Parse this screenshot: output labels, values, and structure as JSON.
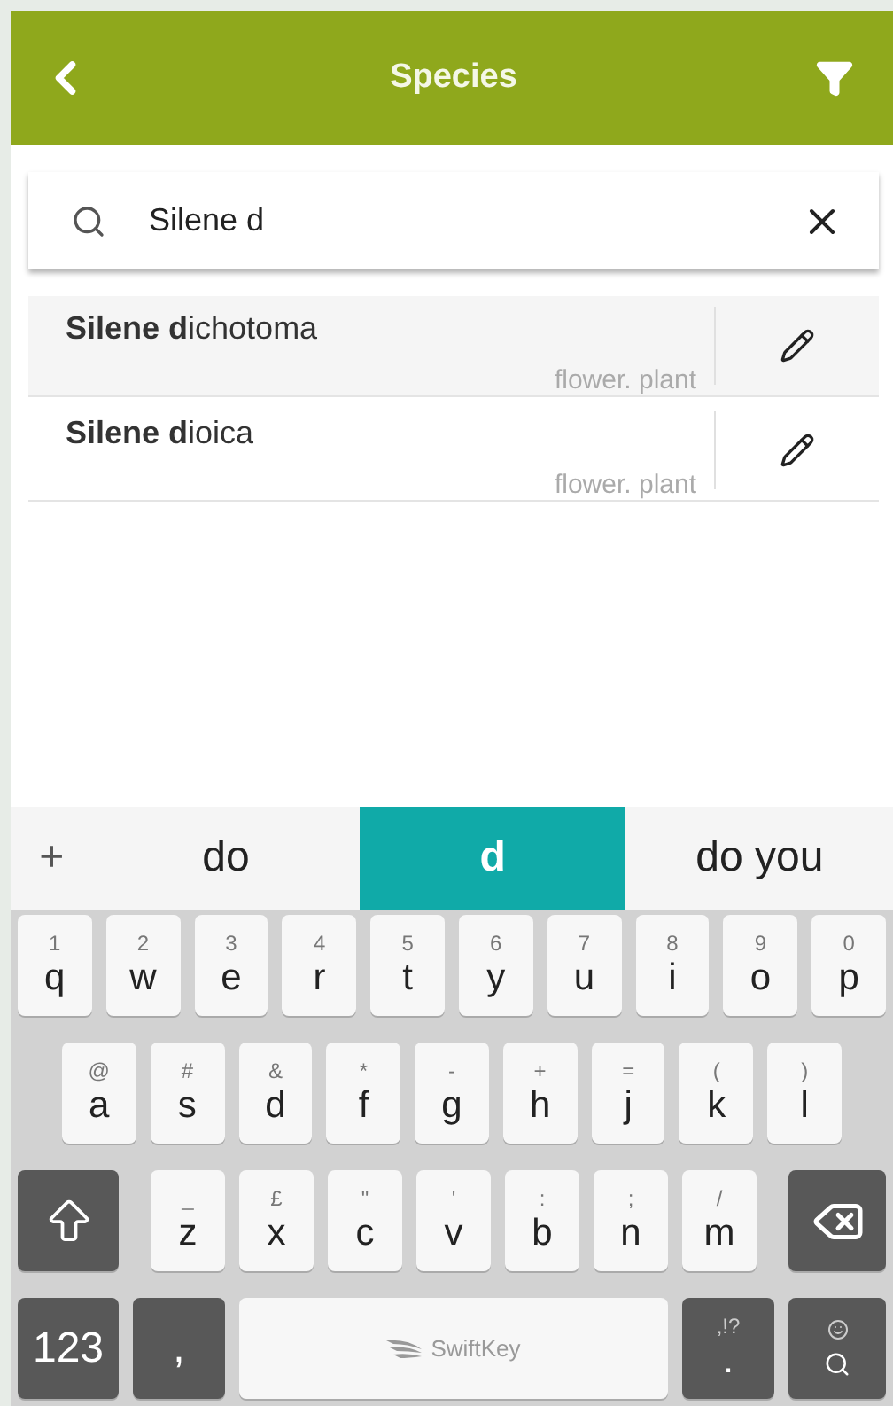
{
  "header": {
    "title": "Species"
  },
  "search": {
    "value": "Silene d"
  },
  "results": [
    {
      "name": "**Silene d**ichotoma",
      "tags": "flower. plant"
    },
    {
      "name": "**Silene d**ioica",
      "tags": "flower. plant"
    }
  ],
  "keyboard": {
    "add": "+",
    "suggestions": [
      {
        "text": "do",
        "selected": false
      },
      {
        "text": "d",
        "selected": true
      },
      {
        "text": "do you",
        "selected": false
      }
    ],
    "rows": [
      [
        {
          "kind": "char",
          "main": "q",
          "alt": "1"
        },
        {
          "kind": "char",
          "main": "w",
          "alt": "2"
        },
        {
          "kind": "char",
          "main": "e",
          "alt": "3"
        },
        {
          "kind": "char",
          "main": "r",
          "alt": "4"
        },
        {
          "kind": "char",
          "main": "t",
          "alt": "5"
        },
        {
          "kind": "char",
          "main": "y",
          "alt": "6"
        },
        {
          "kind": "char",
          "main": "u",
          "alt": "7"
        },
        {
          "kind": "char",
          "main": "i",
          "alt": "8"
        },
        {
          "kind": "char",
          "main": "o",
          "alt": "9"
        },
        {
          "kind": "char",
          "main": "p",
          "alt": "0"
        }
      ],
      [
        {
          "kind": "char",
          "main": "a",
          "alt": "@"
        },
        {
          "kind": "char",
          "main": "s",
          "alt": "#"
        },
        {
          "kind": "char",
          "main": "d",
          "alt": "&"
        },
        {
          "kind": "char",
          "main": "f",
          "alt": "*"
        },
        {
          "kind": "char",
          "main": "g",
          "alt": "-"
        },
        {
          "kind": "char",
          "main": "h",
          "alt": "+"
        },
        {
          "kind": "char",
          "main": "j",
          "alt": "="
        },
        {
          "kind": "char",
          "main": "k",
          "alt": "("
        },
        {
          "kind": "char",
          "main": "l",
          "alt": ")"
        }
      ],
      [
        {
          "kind": "shift"
        },
        {
          "kind": "char",
          "main": "z",
          "alt": "_"
        },
        {
          "kind": "char",
          "main": "x",
          "alt": "£"
        },
        {
          "kind": "char",
          "main": "c",
          "alt": "\""
        },
        {
          "kind": "char",
          "main": "v",
          "alt": "'"
        },
        {
          "kind": "char",
          "main": "b",
          "alt": ":"
        },
        {
          "kind": "char",
          "main": "n",
          "alt": ";"
        },
        {
          "kind": "char",
          "main": "m",
          "alt": "/"
        },
        {
          "kind": "backspace"
        }
      ]
    ],
    "bottom_row": [
      {
        "kind": "dark",
        "main": "123"
      },
      {
        "kind": "dark",
        "main": ","
      },
      {
        "kind": "space",
        "main": "SwiftKey"
      },
      {
        "kind": "dark",
        "main": ".",
        "alt": ",!?"
      },
      {
        "kind": "emoji-search"
      }
    ]
  }
}
